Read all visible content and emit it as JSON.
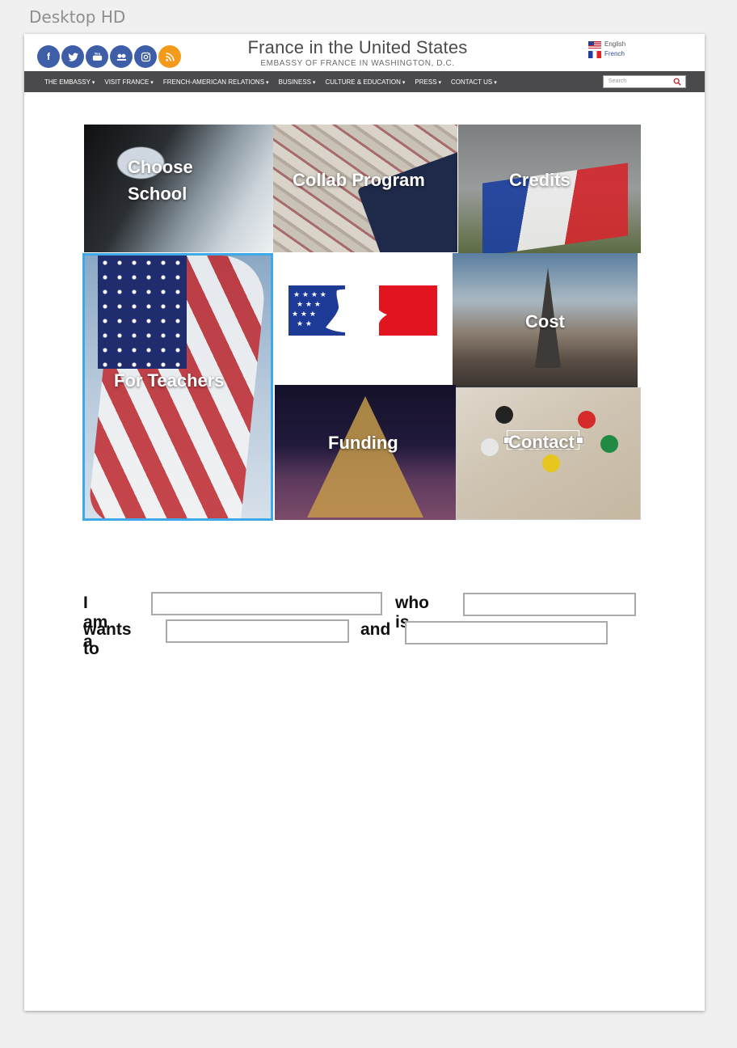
{
  "artboard_label": "Desktop HD",
  "header": {
    "social_icons": [
      {
        "name": "facebook-icon",
        "glyph": "f"
      },
      {
        "name": "twitter-icon",
        "glyph": ""
      },
      {
        "name": "youtube-icon",
        "glyph": ""
      },
      {
        "name": "flickr-icon",
        "glyph": ""
      },
      {
        "name": "instagram-icon",
        "glyph": ""
      },
      {
        "name": "rss-icon",
        "glyph": ""
      }
    ],
    "title": "France in the United States",
    "subtitle": "EMBASSY OF FRANCE IN WASHINGTON, D.C.",
    "lang_english": "English",
    "lang_french": "French",
    "accent": "#3f5ea8",
    "rss_color": "#f39a1d"
  },
  "nav": {
    "items": [
      "THE EMBASSY",
      "VISIT FRANCE",
      "FRENCH-AMERICAN RELATIONS",
      "BUSINESS",
      "CULTURE & EDUCATION",
      "PRESS",
      "CONTACT US"
    ],
    "search_placeholder": "Search"
  },
  "tiles": {
    "choose_school": "Choose\nSchool",
    "collab_program": "Collab Program",
    "credits": "Credits",
    "for_teachers": "For Teachers",
    "cost": "Cost",
    "funding": "Funding",
    "contact": "Contact",
    "selected_border": "#3fa9e7"
  },
  "form": {
    "text_i_am_a": "I am a",
    "text_who_is": "who is",
    "text_wants_to": "wants to",
    "text_and": "and",
    "field1_value": "",
    "field2_value": "",
    "field3_value": "",
    "field4_value": ""
  }
}
